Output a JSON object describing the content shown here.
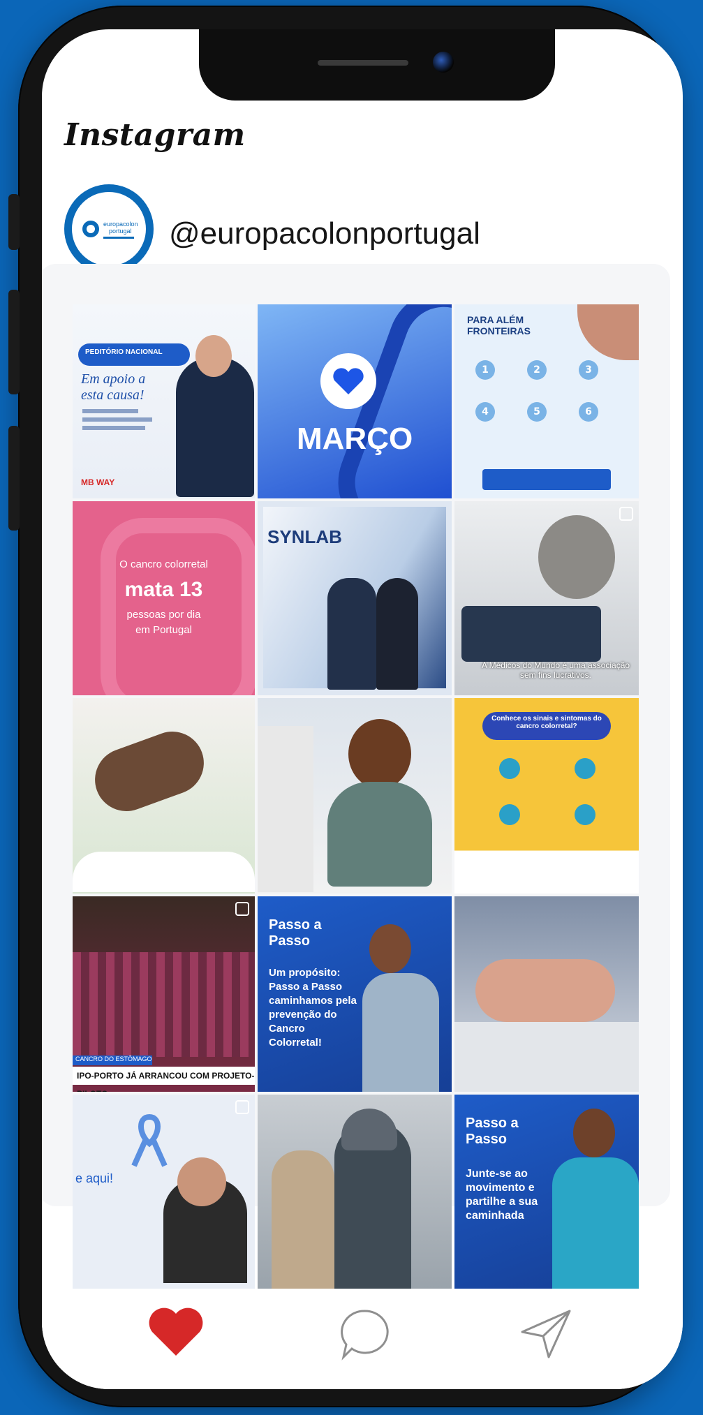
{
  "app": {
    "name": "Instagram"
  },
  "profile": {
    "handle": "@europacolonportugal",
    "logo_text": "europacolon portugal"
  },
  "colors": {
    "background": "#0b66b8",
    "heart": "#d62828",
    "icon_gray": "#8f8f8f"
  },
  "nav": {
    "like_icon": "heart-icon",
    "comment_icon": "comment-icon",
    "share_icon": "send-icon"
  },
  "posts": [
    {
      "title": "Em apoio a esta causa!",
      "badge": "PEDITÓRIO NACIONAL",
      "bar": "MB WAY"
    },
    {
      "title": "MARÇO"
    },
    {
      "title": "PARA ALÉM FRONTEIRAS",
      "steps": [
        "1",
        "2",
        "3",
        "4",
        "5",
        "6"
      ]
    },
    {
      "line1": "O cancro colorretal",
      "line2": "mata 13",
      "line3": "pessoas por dia",
      "line4": "em Portugal"
    },
    {
      "title": "SYNLAB"
    },
    {
      "caption": "A Médicos do Mundo é uma associação sem fins lucrativos."
    },
    {},
    {},
    {
      "title": "Conhece os sinais e sintomas do cancro colorretal?"
    },
    {
      "label": "CANCRO DO ESTÔMAGO",
      "caption": "IPO-PORTO JÁ ARRANCOU COM PROJETO-PILOTO"
    },
    {
      "brand": "Passo a Passo",
      "text": "Um propósito: Passo a Passo caminhamos pela prevenção do Cancro Colorretal!"
    },
    {},
    {
      "text1": "e aqui!"
    },
    {},
    {
      "brand": "Passo a Passo",
      "text": "Junte-se ao movimento e partilhe a sua caminhada"
    }
  ]
}
